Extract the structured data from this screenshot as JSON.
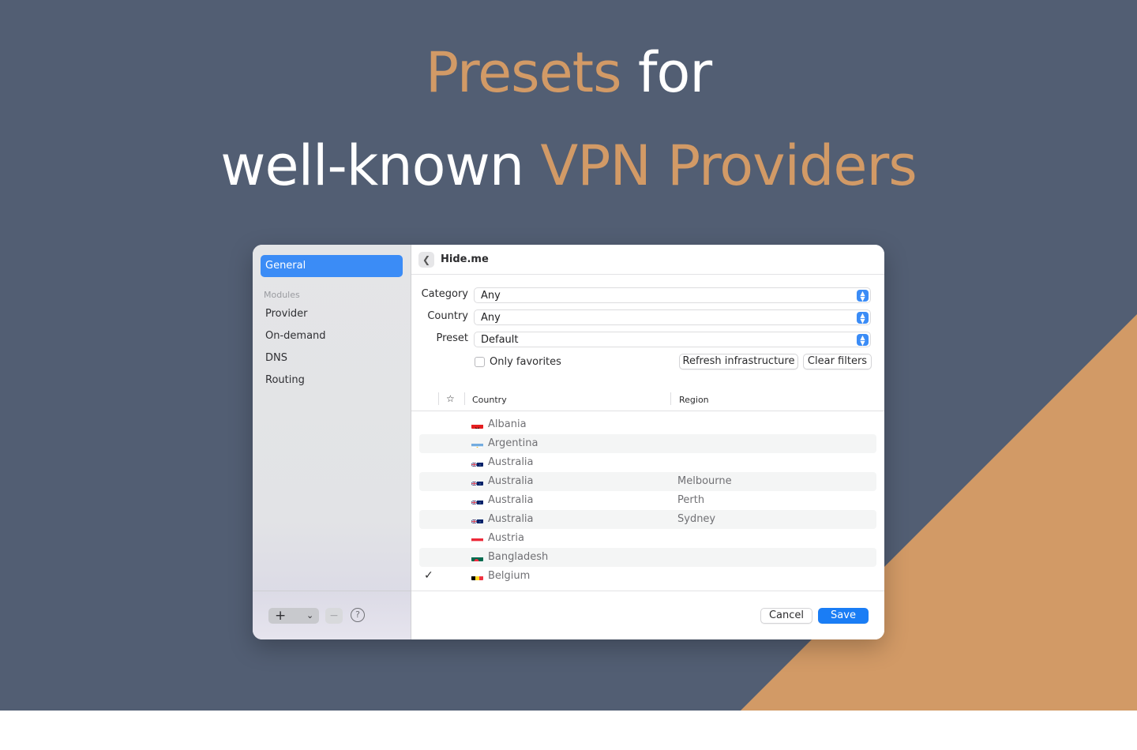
{
  "headline": {
    "line1_accent": "Presets",
    "line1_rest": " for",
    "line2_plain": "well-known ",
    "line2_accent": "VPN Providers"
  },
  "colors": {
    "background": "#525e73",
    "accent": "#d29a66",
    "primary_button": "#1a7df5",
    "selected_sidebar": "#3b8cf6"
  },
  "sidebar": {
    "selected": "General",
    "section_title": "Modules",
    "items": [
      "Provider",
      "On-demand",
      "DNS",
      "Routing"
    ],
    "add_icon": "plus-icon",
    "dropdown_icon": "chevron-down-icon",
    "remove_icon": "minus-icon",
    "help_icon": "question-icon"
  },
  "header": {
    "title": "Hide.me"
  },
  "filters": {
    "category_label": "Category",
    "category_value": "Any",
    "country_label": "Country",
    "country_value": "Any",
    "preset_label": "Preset",
    "preset_value": "Default",
    "only_favorites_label": "Only favorites",
    "refresh_button": "Refresh infrastructure",
    "clear_button": "Clear filters"
  },
  "table": {
    "star_icon": "☆",
    "columns": [
      "Country",
      "Region"
    ],
    "rows": [
      {
        "country": "Albania",
        "region": "",
        "flag": "albania",
        "selected": false
      },
      {
        "country": "Argentina",
        "region": "",
        "flag": "argentina",
        "selected": false
      },
      {
        "country": "Australia",
        "region": "",
        "flag": "australia",
        "selected": false
      },
      {
        "country": "Australia",
        "region": "Melbourne",
        "flag": "australia",
        "selected": false
      },
      {
        "country": "Australia",
        "region": "Perth",
        "flag": "australia",
        "selected": false
      },
      {
        "country": "Australia",
        "region": "Sydney",
        "flag": "australia",
        "selected": false
      },
      {
        "country": "Austria",
        "region": "",
        "flag": "austria",
        "selected": false
      },
      {
        "country": "Bangladesh",
        "region": "",
        "flag": "bangladesh",
        "selected": false
      },
      {
        "country": "Belgium",
        "region": "",
        "flag": "belgium",
        "selected": true
      }
    ]
  },
  "footer": {
    "cancel": "Cancel",
    "save": "Save"
  }
}
